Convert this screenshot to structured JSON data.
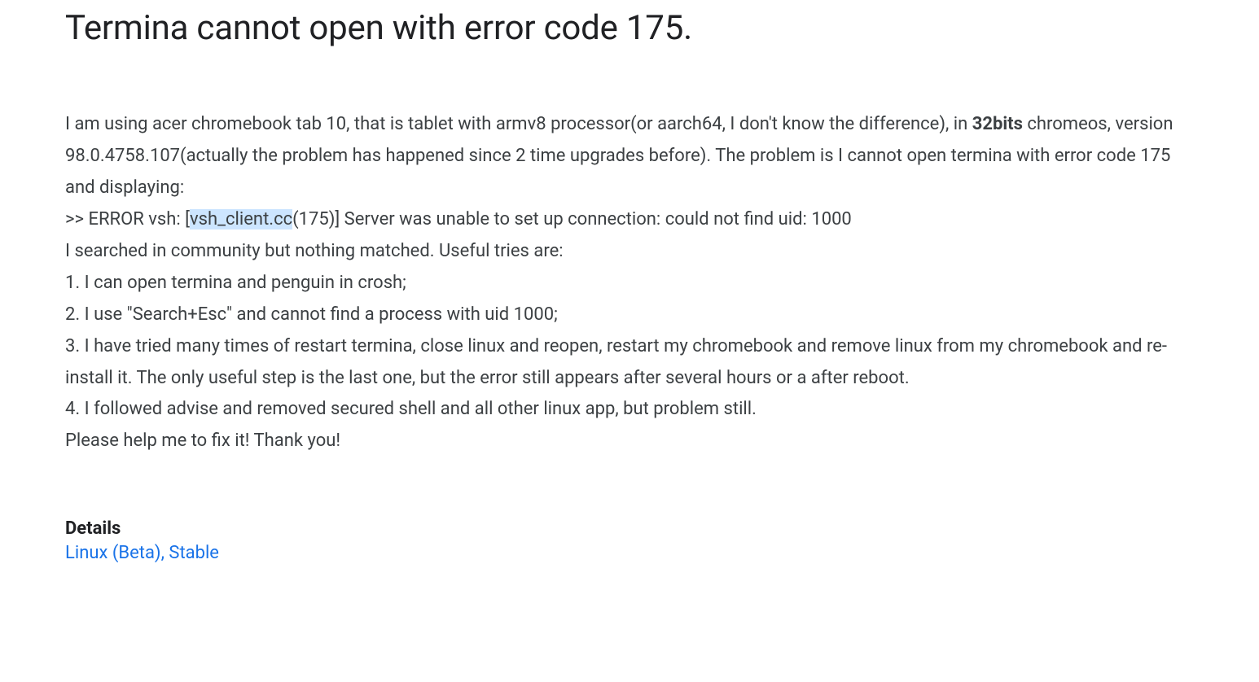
{
  "title": "Termina cannot open with error code 175.",
  "body": {
    "para1_pre": "I am using acer chromebook tab 10, that is tablet with armv8 processor(or aarch64, I don't know the difference), in ",
    "para1_bold": "32bits",
    "para1_post": " chromeos, version 98.0.4758.107(actually the problem has happened since 2 time upgrades before). The problem is I cannot open termina with error code 175 and displaying:",
    "error_pre": ">> ERROR vsh: [",
    "error_highlight": "vsh_client.cc",
    "error_post": "(175)] Server was unable to set up connection: could not find uid: 1000",
    "para2_intro": "I searched in community but nothing matched. Useful tries are:",
    "item1": "1. I can open termina and penguin in crosh;",
    "item2": "2. I use \"Search+Esc\" and cannot find a process with uid 1000;",
    "item3": "3. I have tried many times of restart termina, close linux and reopen, restart my chromebook and remove linux from my chromebook and re-install it. The only useful step is the last one, but the error still appears after several hours or a after reboot.",
    "item4": "4. I followed advise and removed secured shell and all other linux app, but problem still.",
    "closing": "Please help me to fix it! Thank you!"
  },
  "details": {
    "label": "Details",
    "link1": "Linux (Beta)",
    "separator": ", ",
    "link2": "Stable"
  }
}
